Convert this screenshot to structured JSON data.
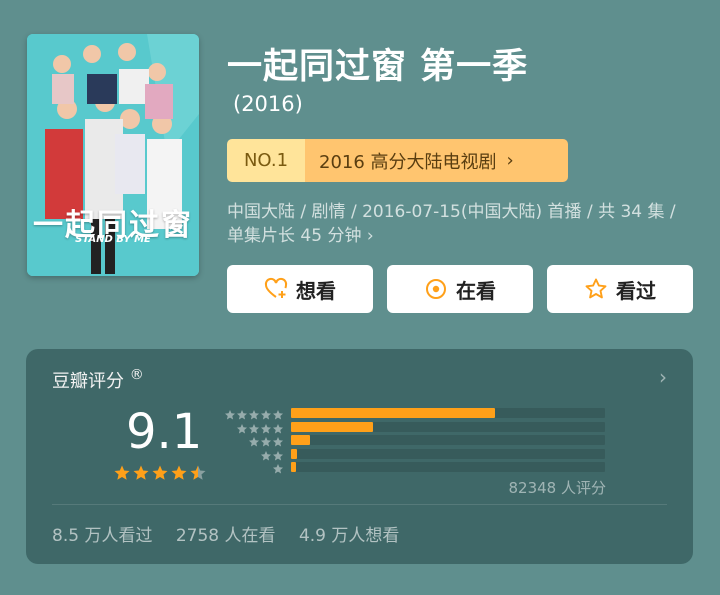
{
  "poster": {
    "title_text": "一起同过窗",
    "subtitle_text": "STAND BY ME"
  },
  "header": {
    "title": "一起同过窗 第一季",
    "year": "(2016)"
  },
  "rank": {
    "badge": "NO.1",
    "label": "2016 高分大陆电视剧",
    "arrow": "›"
  },
  "meta": "中国大陆 / 剧情 / 2016-07-15(中国大陆) 首播 / 共 34 集 / 单集片长 45 分钟 ›",
  "actions": [
    {
      "label": "想看",
      "icon": "heart-plus-icon"
    },
    {
      "label": "在看",
      "icon": "dot-circle-icon"
    },
    {
      "label": "看过",
      "icon": "star-outline-icon"
    }
  ],
  "rating": {
    "header": "豆瓣评分",
    "registered": "®",
    "chevron": "›",
    "score": "9.1",
    "stars": 4.5,
    "distribution": [
      {
        "stars": 5,
        "percent": 65
      },
      {
        "stars": 4,
        "percent": 26
      },
      {
        "stars": 3,
        "percent": 6
      },
      {
        "stars": 2,
        "percent": 2
      },
      {
        "stars": 1,
        "percent": 1.5
      }
    ],
    "count_text": "82348 人评分",
    "stats": [
      "8.5 万人看过",
      "2758 人在看",
      "4.9 万人想看"
    ]
  },
  "colors": {
    "accent": "#ffa019",
    "background": "#5f8f8e",
    "card": "#3f6868"
  }
}
